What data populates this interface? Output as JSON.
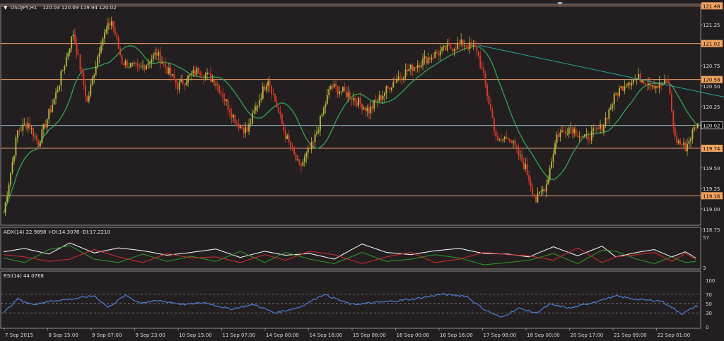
{
  "window": {
    "symbol_header": "USDJPY,H1",
    "ohlc_header": "120.03 120.09 119.94 120.02"
  },
  "indicators": {
    "adx_label": "ADX(14) 22.9898 +DI:14.3076 -DI:17.2210",
    "rsi_label": "RSI(14) 44.0768"
  },
  "colors": {
    "background": "#231f20",
    "grid_border": "#8c8c8c",
    "bull_candle": "#b8b83a",
    "bear_candle": "#e0392a",
    "moving_average": "#2fa45a",
    "trendline": "#2aa39a",
    "level_line": "#e5a173",
    "price_line": "#9eb7c9",
    "adx_line": "#ffffff",
    "plus_di_line": "#2e9b2e",
    "minus_di_line": "#d32c2c",
    "rsi_line": "#4a78c8",
    "level_badge": "#f4a460"
  },
  "chart_data": [
    {
      "type": "candlestick",
      "title": "USDJPY,H1",
      "ylim": [
        118.8,
        121.5
      ],
      "y_ticks": [
        "121.25",
        "120.75",
        "120.50",
        "120.25",
        "119.50",
        "119.25",
        "119.00",
        "118.75"
      ],
      "x_ticks": [
        "7 Sep 2015",
        "8 Sep 15:00",
        "9 Sep 07:00",
        "9 Sep 23:00",
        "10 Sep 15:00",
        "11 Sep 07:00",
        "14 Sep 00:00",
        "14 Sep 16:00",
        "15 Sep 08:00",
        "16 Sep 00:00",
        "16 Sep 16:00",
        "17 Sep 08:00",
        "18 Sep 00:00",
        "20 Sep 17:00",
        "21 Sep 09:00",
        "22 Sep 01:00"
      ],
      "levels": [
        {
          "label": "121.48",
          "value": 121.48
        },
        {
          "label": "121.02",
          "value": 121.02
        },
        {
          "label": "120.58",
          "value": 120.58
        },
        {
          "label": "120.02",
          "value": 120.02
        },
        {
          "label": "119.74",
          "value": 119.74
        },
        {
          "label": "119.16",
          "value": 119.16
        }
      ],
      "current_price": 120.02,
      "close_anchors": [
        [
          0,
          118.95
        ],
        [
          8,
          119.95
        ],
        [
          14,
          120.05
        ],
        [
          20,
          119.8
        ],
        [
          30,
          120.4
        ],
        [
          40,
          121.15
        ],
        [
          48,
          120.3
        ],
        [
          56,
          121.05
        ],
        [
          62,
          121.3
        ],
        [
          68,
          120.8
        ],
        [
          78,
          120.7
        ],
        [
          88,
          120.9
        ],
        [
          100,
          120.5
        ],
        [
          112,
          120.7
        ],
        [
          122,
          120.55
        ],
        [
          134,
          120.05
        ],
        [
          140,
          119.95
        ],
        [
          148,
          120.4
        ],
        [
          152,
          120.6
        ],
        [
          162,
          119.9
        ],
        [
          170,
          119.5
        ],
        [
          178,
          119.8
        ],
        [
          188,
          120.5
        ],
        [
          198,
          120.4
        ],
        [
          210,
          120.2
        ],
        [
          226,
          120.6
        ],
        [
          240,
          120.8
        ],
        [
          254,
          120.95
        ],
        [
          264,
          121.02
        ],
        [
          272,
          120.95
        ],
        [
          276,
          120.6
        ],
        [
          284,
          119.8
        ],
        [
          290,
          119.9
        ],
        [
          300,
          119.5
        ],
        [
          306,
          119.1
        ],
        [
          312,
          119.3
        ],
        [
          318,
          119.9
        ],
        [
          326,
          120.0
        ],
        [
          334,
          119.85
        ],
        [
          344,
          120.0
        ],
        [
          352,
          120.4
        ],
        [
          358,
          120.55
        ],
        [
          366,
          120.6
        ],
        [
          376,
          120.5
        ],
        [
          382,
          120.55
        ],
        [
          386,
          119.85
        ],
        [
          392,
          119.75
        ],
        [
          398,
          120.02
        ]
      ],
      "ma_period": 20,
      "trendline": {
        "from": [
          273,
          121.0
        ],
        "to": [
          440,
          120.25
        ]
      }
    },
    {
      "type": "line",
      "title": "ADX(14) 22.9898 +DI:14.3076 -DI:17.2210",
      "ylim": [
        3,
        57
      ],
      "y_ticks": [
        "57",
        "3"
      ],
      "series": [
        {
          "name": "ADX",
          "anchors": [
            [
              0,
              31
            ],
            [
              12,
              37
            ],
            [
              26,
              27
            ],
            [
              38,
              47
            ],
            [
              52,
              29
            ],
            [
              66,
              38
            ],
            [
              80,
              33
            ],
            [
              94,
              25
            ],
            [
              108,
              30
            ],
            [
              122,
              36
            ],
            [
              136,
              21
            ],
            [
              150,
              32
            ],
            [
              162,
              25
            ],
            [
              176,
              28
            ],
            [
              190,
              18
            ],
            [
              206,
              45
            ],
            [
              220,
              30
            ],
            [
              234,
              26
            ],
            [
              248,
              33
            ],
            [
              262,
              37
            ],
            [
              276,
              28
            ],
            [
              290,
              27
            ],
            [
              302,
              22
            ],
            [
              316,
              40
            ],
            [
              330,
              24
            ],
            [
              344,
              41
            ],
            [
              352,
              22
            ],
            [
              364,
              30
            ],
            [
              374,
              35
            ],
            [
              384,
              22
            ],
            [
              392,
              31
            ],
            [
              398,
              20
            ]
          ]
        },
        {
          "name": "+DI",
          "anchors": [
            [
              0,
              20
            ],
            [
              12,
              12
            ],
            [
              26,
              35
            ],
            [
              38,
              42
            ],
            [
              52,
              18
            ],
            [
              66,
              12
            ],
            [
              80,
              27
            ],
            [
              94,
              14
            ],
            [
              108,
              23
            ],
            [
              122,
              14
            ],
            [
              136,
              32
            ],
            [
              150,
              12
            ],
            [
              162,
              30
            ],
            [
              176,
              18
            ],
            [
              190,
              10
            ],
            [
              206,
              30
            ],
            [
              220,
              14
            ],
            [
              234,
              18
            ],
            [
              248,
              26
            ],
            [
              262,
              20
            ],
            [
              276,
              8
            ],
            [
              290,
              12
            ],
            [
              302,
              16
            ],
            [
              316,
              28
            ],
            [
              330,
              10
            ],
            [
              344,
              34
            ],
            [
              352,
              32
            ],
            [
              364,
              18
            ],
            [
              374,
              10
            ],
            [
              384,
              22
            ],
            [
              392,
              12
            ],
            [
              398,
              14
            ]
          ]
        },
        {
          "name": "-DI",
          "anchors": [
            [
              0,
              26
            ],
            [
              12,
              22
            ],
            [
              26,
              14
            ],
            [
              38,
              18
            ],
            [
              52,
              35
            ],
            [
              66,
              22
            ],
            [
              80,
              12
            ],
            [
              94,
              28
            ],
            [
              108,
              20
            ],
            [
              122,
              22
            ],
            [
              136,
              12
            ],
            [
              150,
              26
            ],
            [
              162,
              16
            ],
            [
              176,
              32
            ],
            [
              190,
              26
            ],
            [
              206,
              10
            ],
            [
              220,
              22
            ],
            [
              234,
              30
            ],
            [
              248,
              12
            ],
            [
              262,
              18
            ],
            [
              276,
              30
            ],
            [
              290,
              26
            ],
            [
              302,
              24
            ],
            [
              316,
              16
            ],
            [
              330,
              38
            ],
            [
              344,
              12
            ],
            [
              352,
              22
            ],
            [
              364,
              26
            ],
            [
              374,
              30
            ],
            [
              384,
              14
            ],
            [
              392,
              28
            ],
            [
              398,
              17
            ]
          ]
        }
      ]
    },
    {
      "type": "line",
      "title": "RSI(14) 44.0768",
      "ylim": [
        0,
        100
      ],
      "y_ticks": [
        "100",
        "70",
        "50",
        "30",
        "0"
      ],
      "dashed_levels": [
        70,
        50,
        30
      ],
      "series": [
        {
          "name": "RSI",
          "anchors": [
            [
              0,
              30
            ],
            [
              8,
              60
            ],
            [
              16,
              48
            ],
            [
              28,
              56
            ],
            [
              40,
              60
            ],
            [
              52,
              67
            ],
            [
              60,
              42
            ],
            [
              70,
              68
            ],
            [
              78,
              52
            ],
            [
              90,
              56
            ],
            [
              104,
              48
            ],
            [
              116,
              52
            ],
            [
              130,
              38
            ],
            [
              144,
              48
            ],
            [
              156,
              30
            ],
            [
              170,
              42
            ],
            [
              184,
              70
            ],
            [
              200,
              48
            ],
            [
              220,
              54
            ],
            [
              236,
              60
            ],
            [
              252,
              70
            ],
            [
              266,
              66
            ],
            [
              276,
              38
            ],
            [
              286,
              20
            ],
            [
              296,
              40
            ],
            [
              306,
              30
            ],
            [
              314,
              48
            ],
            [
              326,
              40
            ],
            [
              338,
              52
            ],
            [
              352,
              66
            ],
            [
              366,
              58
            ],
            [
              378,
              56
            ],
            [
              384,
              42
            ],
            [
              390,
              28
            ],
            [
              398,
              44
            ]
          ]
        }
      ]
    }
  ]
}
